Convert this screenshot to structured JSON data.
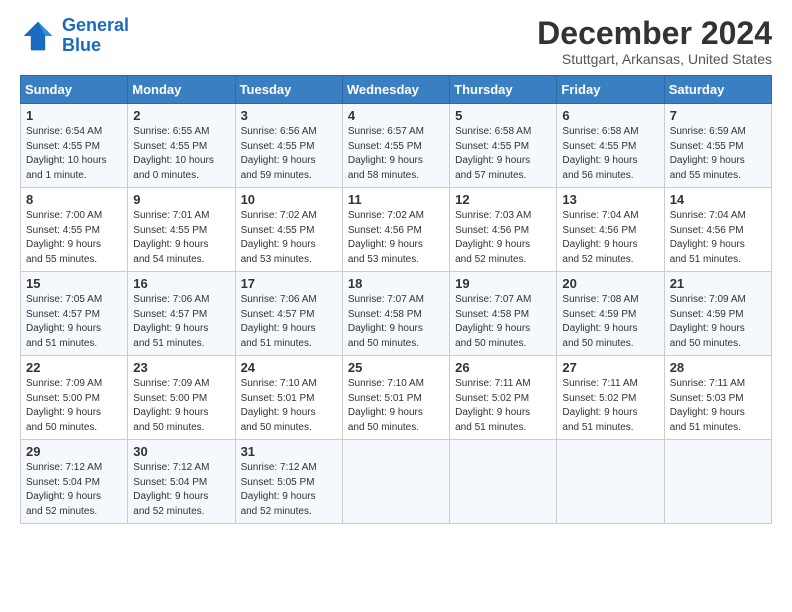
{
  "header": {
    "logo_line1": "General",
    "logo_line2": "Blue",
    "month_title": "December 2024",
    "location": "Stuttgart, Arkansas, United States"
  },
  "days_of_week": [
    "Sunday",
    "Monday",
    "Tuesday",
    "Wednesday",
    "Thursday",
    "Friday",
    "Saturday"
  ],
  "weeks": [
    [
      {
        "day": "1",
        "info": "Sunrise: 6:54 AM\nSunset: 4:55 PM\nDaylight: 10 hours\nand 1 minute."
      },
      {
        "day": "2",
        "info": "Sunrise: 6:55 AM\nSunset: 4:55 PM\nDaylight: 10 hours\nand 0 minutes."
      },
      {
        "day": "3",
        "info": "Sunrise: 6:56 AM\nSunset: 4:55 PM\nDaylight: 9 hours\nand 59 minutes."
      },
      {
        "day": "4",
        "info": "Sunrise: 6:57 AM\nSunset: 4:55 PM\nDaylight: 9 hours\nand 58 minutes."
      },
      {
        "day": "5",
        "info": "Sunrise: 6:58 AM\nSunset: 4:55 PM\nDaylight: 9 hours\nand 57 minutes."
      },
      {
        "day": "6",
        "info": "Sunrise: 6:58 AM\nSunset: 4:55 PM\nDaylight: 9 hours\nand 56 minutes."
      },
      {
        "day": "7",
        "info": "Sunrise: 6:59 AM\nSunset: 4:55 PM\nDaylight: 9 hours\nand 55 minutes."
      }
    ],
    [
      {
        "day": "8",
        "info": "Sunrise: 7:00 AM\nSunset: 4:55 PM\nDaylight: 9 hours\nand 55 minutes."
      },
      {
        "day": "9",
        "info": "Sunrise: 7:01 AM\nSunset: 4:55 PM\nDaylight: 9 hours\nand 54 minutes."
      },
      {
        "day": "10",
        "info": "Sunrise: 7:02 AM\nSunset: 4:55 PM\nDaylight: 9 hours\nand 53 minutes."
      },
      {
        "day": "11",
        "info": "Sunrise: 7:02 AM\nSunset: 4:56 PM\nDaylight: 9 hours\nand 53 minutes."
      },
      {
        "day": "12",
        "info": "Sunrise: 7:03 AM\nSunset: 4:56 PM\nDaylight: 9 hours\nand 52 minutes."
      },
      {
        "day": "13",
        "info": "Sunrise: 7:04 AM\nSunset: 4:56 PM\nDaylight: 9 hours\nand 52 minutes."
      },
      {
        "day": "14",
        "info": "Sunrise: 7:04 AM\nSunset: 4:56 PM\nDaylight: 9 hours\nand 51 minutes."
      }
    ],
    [
      {
        "day": "15",
        "info": "Sunrise: 7:05 AM\nSunset: 4:57 PM\nDaylight: 9 hours\nand 51 minutes."
      },
      {
        "day": "16",
        "info": "Sunrise: 7:06 AM\nSunset: 4:57 PM\nDaylight: 9 hours\nand 51 minutes."
      },
      {
        "day": "17",
        "info": "Sunrise: 7:06 AM\nSunset: 4:57 PM\nDaylight: 9 hours\nand 51 minutes."
      },
      {
        "day": "18",
        "info": "Sunrise: 7:07 AM\nSunset: 4:58 PM\nDaylight: 9 hours\nand 50 minutes."
      },
      {
        "day": "19",
        "info": "Sunrise: 7:07 AM\nSunset: 4:58 PM\nDaylight: 9 hours\nand 50 minutes."
      },
      {
        "day": "20",
        "info": "Sunrise: 7:08 AM\nSunset: 4:59 PM\nDaylight: 9 hours\nand 50 minutes."
      },
      {
        "day": "21",
        "info": "Sunrise: 7:09 AM\nSunset: 4:59 PM\nDaylight: 9 hours\nand 50 minutes."
      }
    ],
    [
      {
        "day": "22",
        "info": "Sunrise: 7:09 AM\nSunset: 5:00 PM\nDaylight: 9 hours\nand 50 minutes."
      },
      {
        "day": "23",
        "info": "Sunrise: 7:09 AM\nSunset: 5:00 PM\nDaylight: 9 hours\nand 50 minutes."
      },
      {
        "day": "24",
        "info": "Sunrise: 7:10 AM\nSunset: 5:01 PM\nDaylight: 9 hours\nand 50 minutes."
      },
      {
        "day": "25",
        "info": "Sunrise: 7:10 AM\nSunset: 5:01 PM\nDaylight: 9 hours\nand 50 minutes."
      },
      {
        "day": "26",
        "info": "Sunrise: 7:11 AM\nSunset: 5:02 PM\nDaylight: 9 hours\nand 51 minutes."
      },
      {
        "day": "27",
        "info": "Sunrise: 7:11 AM\nSunset: 5:02 PM\nDaylight: 9 hours\nand 51 minutes."
      },
      {
        "day": "28",
        "info": "Sunrise: 7:11 AM\nSunset: 5:03 PM\nDaylight: 9 hours\nand 51 minutes."
      }
    ],
    [
      {
        "day": "29",
        "info": "Sunrise: 7:12 AM\nSunset: 5:04 PM\nDaylight: 9 hours\nand 52 minutes."
      },
      {
        "day": "30",
        "info": "Sunrise: 7:12 AM\nSunset: 5:04 PM\nDaylight: 9 hours\nand 52 minutes."
      },
      {
        "day": "31",
        "info": "Sunrise: 7:12 AM\nSunset: 5:05 PM\nDaylight: 9 hours\nand 52 minutes."
      },
      {
        "day": "",
        "info": ""
      },
      {
        "day": "",
        "info": ""
      },
      {
        "day": "",
        "info": ""
      },
      {
        "day": "",
        "info": ""
      }
    ]
  ]
}
